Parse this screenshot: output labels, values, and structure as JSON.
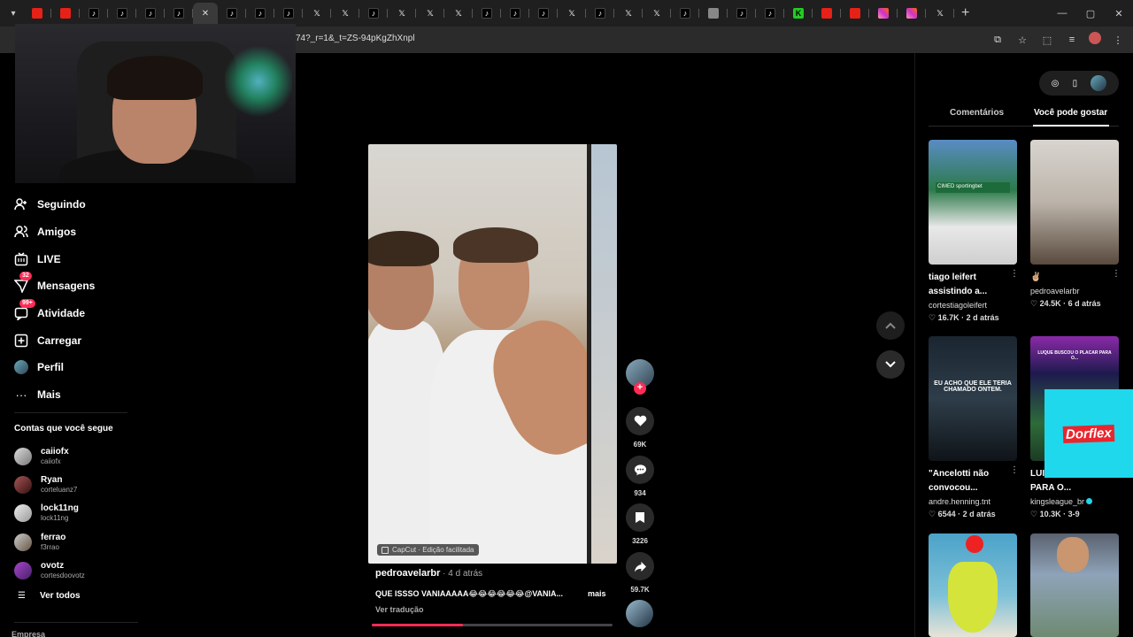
{
  "browser": {
    "url": "74?_r=1&_t=ZS-94pKgZhXnpl",
    "tabs": [
      "yt",
      "yt",
      "tt",
      "tt",
      "tt",
      "tt",
      "active",
      "tt",
      "tt",
      "tt",
      "x",
      "x",
      "tt",
      "x",
      "x",
      "x",
      "tt",
      "tt",
      "tt",
      "x",
      "tt",
      "x",
      "x",
      "tt",
      "chrome",
      "tt",
      "tt",
      "k",
      "yt",
      "yt",
      "ig",
      "ig",
      "x"
    ],
    "new_tab": "+",
    "window_controls": [
      "—",
      "▢",
      "✕"
    ]
  },
  "sidebar": {
    "nav": [
      {
        "label": "Seguindo",
        "icon": "following-icon"
      },
      {
        "label": "Amigos",
        "icon": "friends-icon"
      },
      {
        "label": "LIVE",
        "icon": "live-icon"
      },
      {
        "label": "Mensagens",
        "icon": "messages-icon",
        "badge": "32"
      },
      {
        "label": "Atividade",
        "icon": "activity-icon",
        "badge": "99+"
      },
      {
        "label": "Carregar",
        "icon": "upload-icon"
      },
      {
        "label": "Perfil",
        "icon": "profile-avatar"
      },
      {
        "label": "Mais",
        "icon": "more-icon"
      }
    ],
    "following_title": "Contas que você segue",
    "accounts": [
      {
        "name": "caiiofx",
        "handle": "caiiofx"
      },
      {
        "name": "Ryan",
        "handle": "corteluanz7"
      },
      {
        "name": "lock11ng",
        "handle": "lock11ng"
      },
      {
        "name": "ferrao",
        "handle": "f3rrao"
      },
      {
        "name": "ovotz",
        "handle": "cortesdoovotz"
      }
    ],
    "see_all": "Ver todos",
    "company": "Empresa"
  },
  "video": {
    "capcut_label": "CapCut · Edição facilitada",
    "author": "pedroavelarbr",
    "time": " · 4 d atrás",
    "caption": "QUE ISSSO VANIAAAAA😂😂😂😂😂😂@VANIA...",
    "more": "mais",
    "translate": "Ver tradução",
    "progress": 0.38
  },
  "actions": {
    "likes": "69K",
    "comments": "934",
    "saves": "3226",
    "shares": "59.7K"
  },
  "right_panel": {
    "tabs": [
      "Comentários",
      "Você pode gostar"
    ],
    "active_tab": 1,
    "cards": [
      {
        "title": "tiago leifert assistindo a...",
        "author": "cortestiagoleifert",
        "likes": "16.7K",
        "time": "2 d atrás",
        "thumb_text": "CIMED sportingbet"
      },
      {
        "title": "✌🏼",
        "author": "pedroavelarbr",
        "likes": "24.5K",
        "time": "6 d atrás"
      },
      {
        "title": "\"Ancelotti não convocou...",
        "author": "andre.henning.tnt",
        "likes": "6544",
        "time": "2 d atrás",
        "thumb_text": "EU ACHO QUE ELE TERIA CHAMADO ONTEM."
      },
      {
        "title": "LUI... PLACAR PARA O...",
        "author": "kingsleague_br",
        "likes": "10.3K",
        "time": "3-9",
        "thumb_text": "LUQUE BUSCOU O PLACAR PARA O..."
      },
      {
        "title": "",
        "author": "",
        "likes": "",
        "time": ""
      },
      {
        "title": "",
        "author": "",
        "likes": "",
        "time": ""
      }
    ]
  },
  "ad": {
    "brand": "Dorflex"
  }
}
